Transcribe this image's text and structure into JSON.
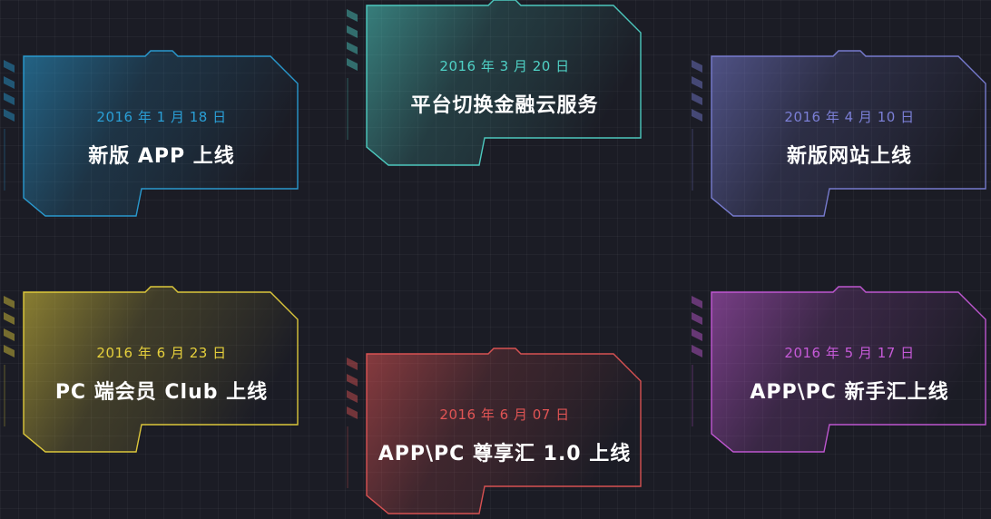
{
  "colors": {
    "background": "#1b1c25",
    "card_blue": "#2a9fd6",
    "card_teal": "#4fd1c5",
    "card_indigo": "#7b7fd6",
    "card_yellow": "#e6d03c",
    "card_red": "#e05454",
    "card_purple": "#c65ad8"
  },
  "milestones": [
    {
      "date": "2016 年 1 月 18 日",
      "title": "新版 APP 上线",
      "color": "#2a9fd6"
    },
    {
      "date": "2016 年 3 月 20 日",
      "title": "平台切换金融云服务",
      "color": "#4fd1c5"
    },
    {
      "date": "2016 年 4 月 10 日",
      "title": "新版网站上线",
      "color": "#7b7fd6"
    },
    {
      "date": "2016 年 6 月 23 日",
      "title": "PC 端会员 Club 上线",
      "color": "#e6d03c"
    },
    {
      "date": "2016 年 6 月 07 日",
      "title": "APP\\PC 尊享汇 1.0 上线",
      "color": "#e05454"
    },
    {
      "date": "2016 年 5 月 17 日",
      "title": "APP\\PC 新手汇上线",
      "color": "#c65ad8"
    }
  ]
}
